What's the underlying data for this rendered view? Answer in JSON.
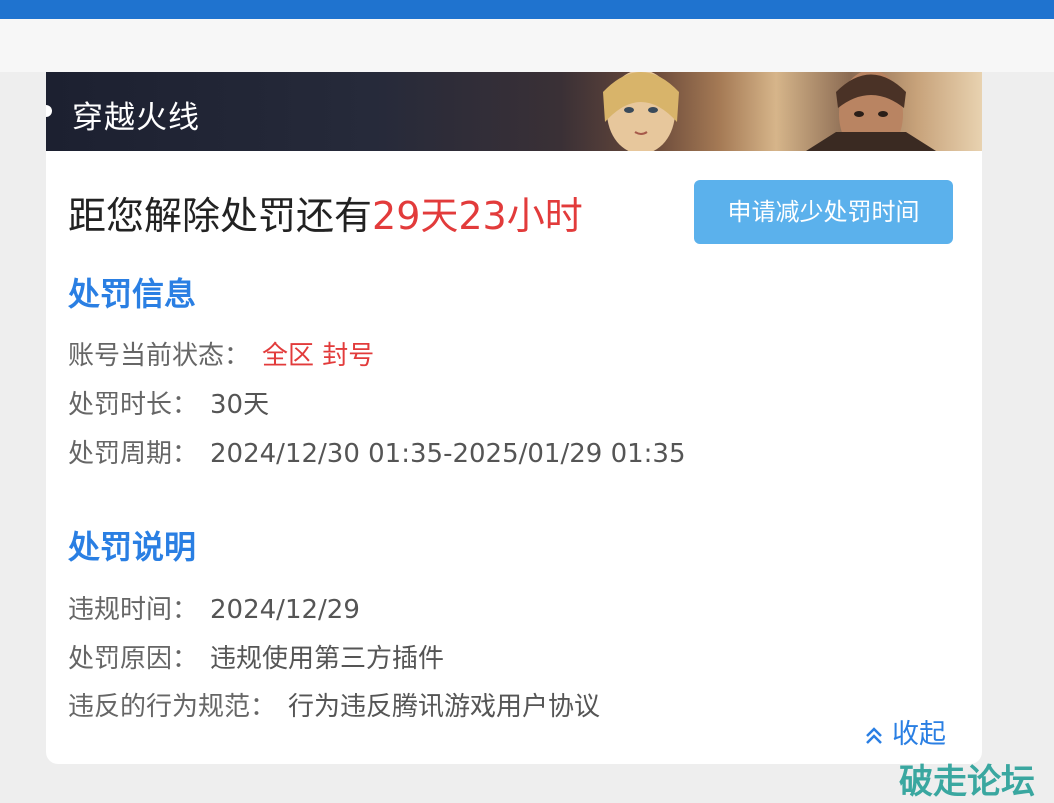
{
  "banner": {
    "title": "穿越火线"
  },
  "countdown": {
    "prefix": "距您解除处罚还有",
    "remaining": "29天23小时"
  },
  "reduce_button": {
    "label": "申请减少处罚时间"
  },
  "penalty_info": {
    "title": "处罚信息",
    "rows": [
      {
        "label": "账号当前状态：",
        "value": "全区 封号"
      },
      {
        "label": "处罚时长：",
        "value": "30天"
      },
      {
        "label": "处罚周期：",
        "value": "2024/12/30 01:35-2025/01/29 01:35"
      }
    ]
  },
  "penalty_desc": {
    "title": "处罚说明",
    "rows": [
      {
        "label": "违规时间：",
        "value": "2024/12/29"
      },
      {
        "label": "处罚原因：",
        "value": "违规使用第三方插件"
      },
      {
        "label": "违反的行为规范：",
        "value": "行为违反腾讯游戏用户协议"
      }
    ]
  },
  "collapse": {
    "label": "收起",
    "icon": "chevron-up-double-icon"
  },
  "watermark": {
    "text": "破走论坛"
  },
  "colors": {
    "accent": "#2a7fe3",
    "alert": "#e23b3b",
    "button": "#5bb1ec",
    "topbar": "#1f73cf"
  }
}
